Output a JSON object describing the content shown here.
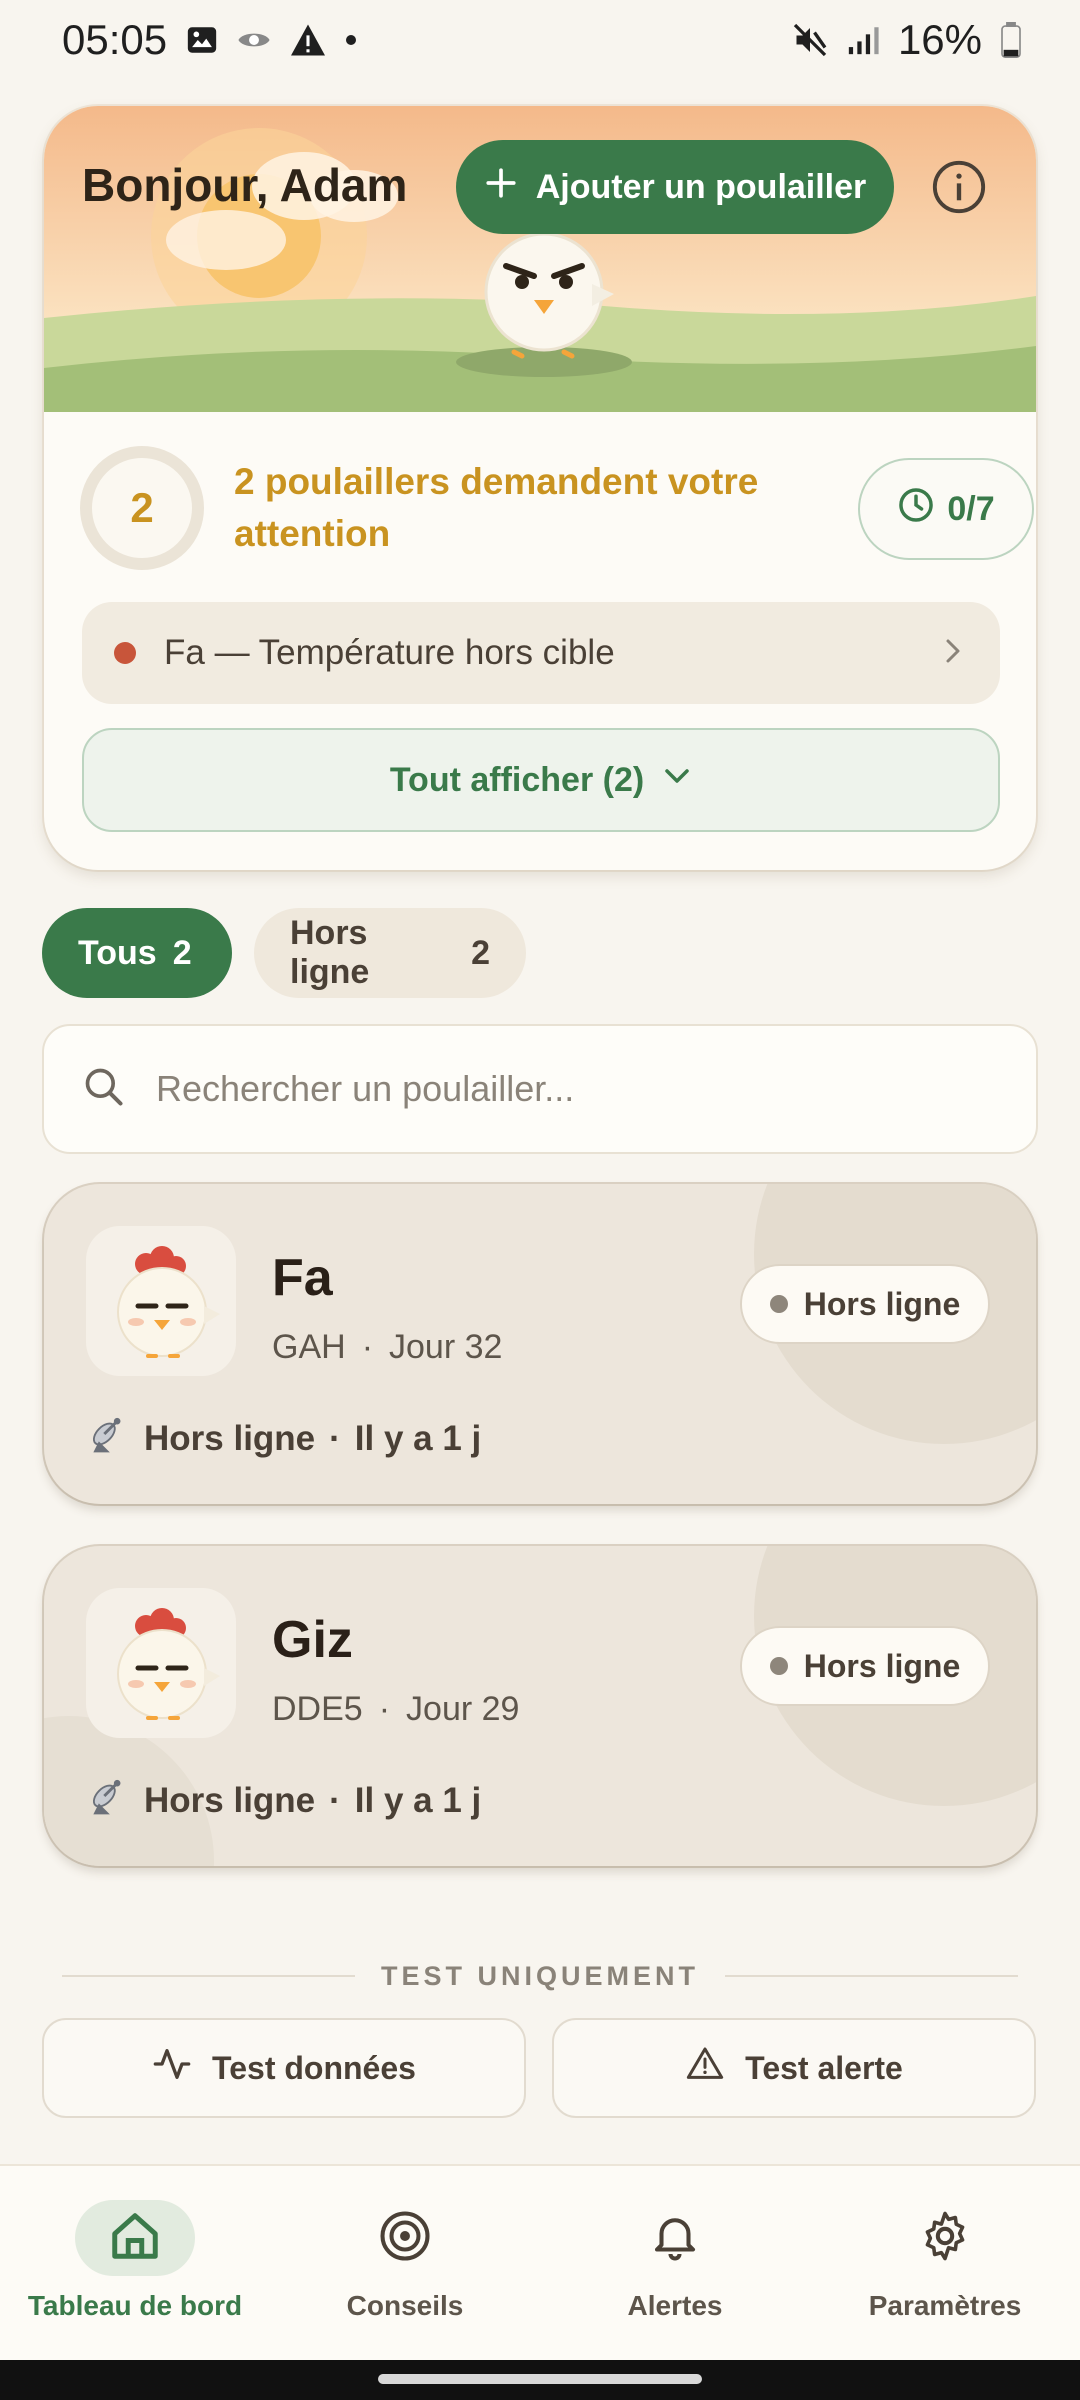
{
  "status_bar": {
    "time": "05:05",
    "battery": "16%"
  },
  "header": {
    "greeting": "Bonjour, Adam",
    "add_label": "Ajouter un poulailler"
  },
  "attention": {
    "count": "2",
    "message": "2 poulaillers demandent votre attention",
    "timer": "0/7",
    "alert_text": "Fa — Température hors cible",
    "show_all": "Tout afficher (2)"
  },
  "filters": [
    {
      "label": "Tous",
      "count": "2"
    },
    {
      "label": "Hors ligne",
      "count": "2"
    }
  ],
  "search": {
    "placeholder": "Rechercher un poulailler..."
  },
  "coops": [
    {
      "name": "Fa",
      "code": "GAH",
      "sep": "·",
      "day": "Jour 32",
      "status": "Hors ligne",
      "conn": "Hors ligne",
      "conn_sep": "·",
      "ago": "Il y a 1 j"
    },
    {
      "name": "Giz",
      "code": "DDE5",
      "sep": "·",
      "day": "Jour 29",
      "status": "Hors ligne",
      "conn": "Hors ligne",
      "conn_sep": "·",
      "ago": "Il y a 1 j"
    }
  ],
  "test": {
    "label": "TEST UNIQUEMENT",
    "data_btn": "Test données",
    "alert_btn": "Test alerte"
  },
  "nav": [
    {
      "label": "Tableau de bord",
      "icon": "home-icon"
    },
    {
      "label": "Conseils",
      "icon": "target-icon"
    },
    {
      "label": "Alertes",
      "icon": "bell-icon"
    },
    {
      "label": "Paramètres",
      "icon": "gear-icon"
    }
  ],
  "colors": {
    "primary": "#3a7a4a",
    "warning": "#c99320",
    "alert": "#c8553a",
    "background": "#f8f5ef"
  }
}
